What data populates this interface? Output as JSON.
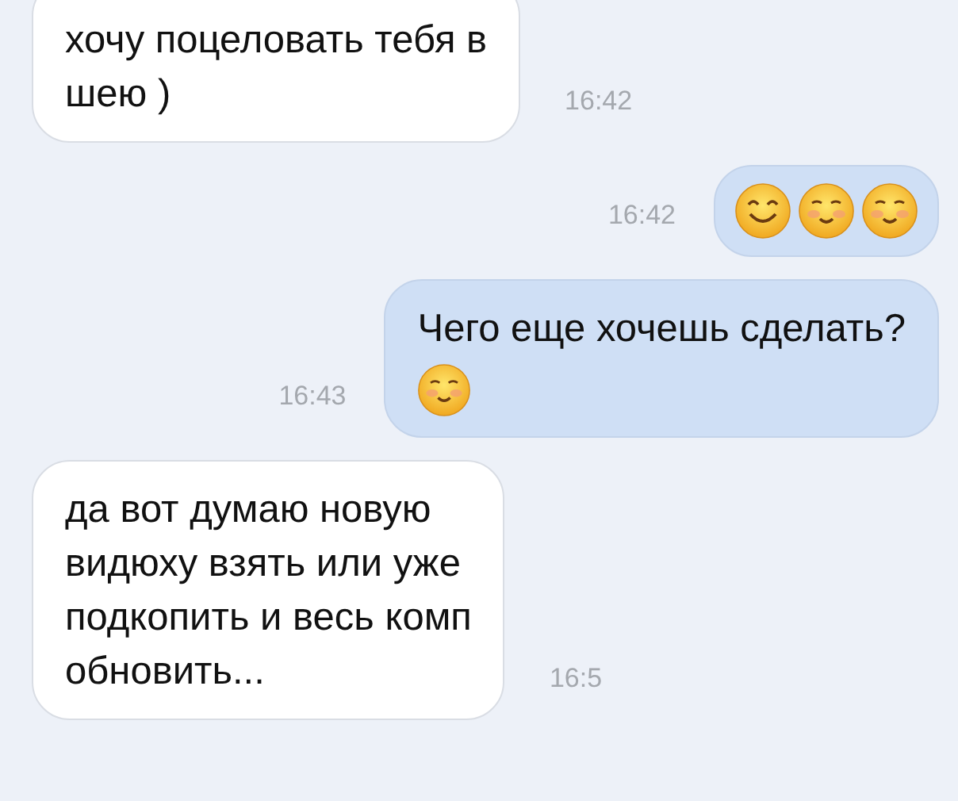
{
  "messages": [
    {
      "outgoing": false,
      "text": "хочу поцеловать тебя в\nшею )",
      "time": "16:42"
    },
    {
      "outgoing": true,
      "time": "16:42",
      "emoji": [
        {
          "kind": "smile"
        },
        {
          "kind": "blush"
        },
        {
          "kind": "blush"
        }
      ]
    },
    {
      "outgoing": true,
      "text": "Чего еще хочешь сделать?",
      "time": "16:43",
      "emoji": [
        {
          "kind": "blush"
        }
      ]
    },
    {
      "outgoing": false,
      "text": "да вот думаю новую\nвидюху взять или уже\nподкопить и весь комп\nобновить...",
      "time": "16:5"
    }
  ]
}
